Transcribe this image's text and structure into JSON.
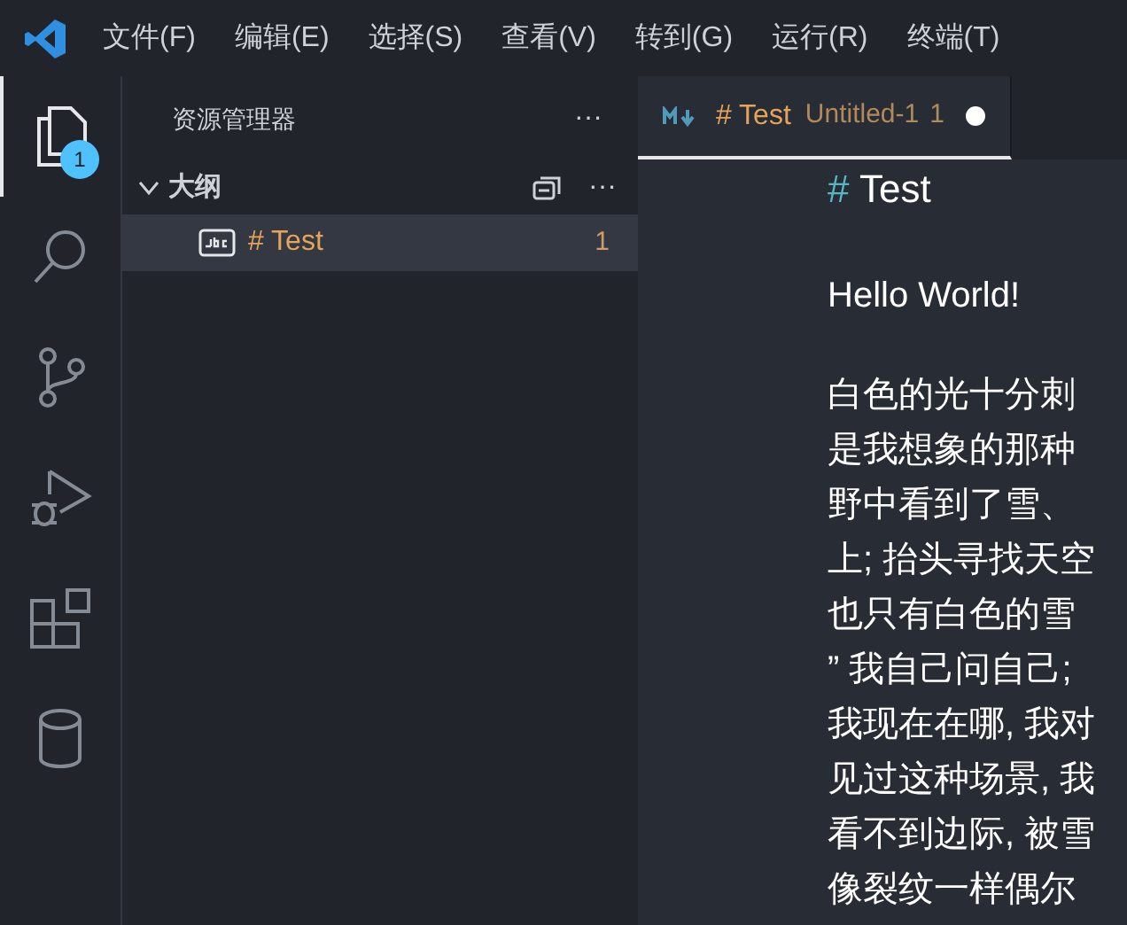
{
  "menu": [
    "文件(F)",
    "编辑(E)",
    "选择(S)",
    "查看(V)",
    "转到(G)",
    "运行(R)",
    "终端(T)"
  ],
  "activity_bar": [
    {
      "kind": "files",
      "selected": true,
      "badge": "1"
    },
    {
      "kind": "search",
      "selected": false
    },
    {
      "kind": "source-control",
      "selected": false
    },
    {
      "kind": "run-debug",
      "selected": false
    },
    {
      "kind": "extensions",
      "selected": false
    },
    {
      "kind": "database",
      "selected": false
    }
  ],
  "sidebar": {
    "title": "资源管理器",
    "more": "···",
    "section": {
      "title": "大纲",
      "expanded": true,
      "more": "···",
      "items": [
        {
          "label": "# Test",
          "count": "1",
          "selected": true
        }
      ]
    }
  },
  "tabs": [
    {
      "title": "# Test",
      "description": "Untitled-1",
      "problems": "1",
      "dirty": true,
      "selected": true
    }
  ],
  "editor": {
    "heading_mark": "#",
    "heading": "Test",
    "paragraphs": [
      "Hello World!"
    ],
    "lines": [
      "白色的光十分刺",
      "是我想象的那种",
      "野中看到了雪、",
      "上; 抬头寻找天空",
      "也只有白色的雪",
      "”  我自己问自己;",
      "我现在在哪, 我对",
      "见过这种场景, 我",
      "看不到边际, 被雪",
      "像裂纹一样偶尔"
    ]
  }
}
